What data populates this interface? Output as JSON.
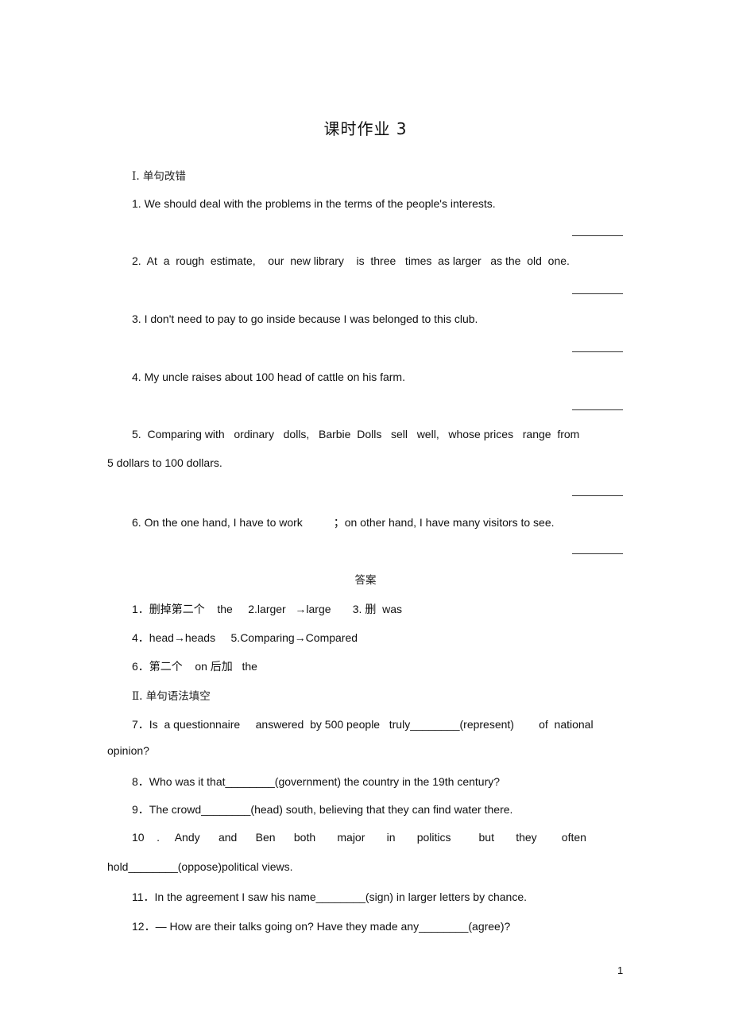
{
  "document": {
    "title": "课时作业 3",
    "page_number": "1"
  },
  "section1": {
    "heading": "Ⅰ. 单句改错",
    "items": [
      "1. We should deal with the problems in the terms of the people's interests.",
      "2.  At  a  rough  estimate,    our  new library    is  three   times  as larger   as the  old  one.",
      "3. I don't need to pay to go inside because I was belonged to this club.",
      "4. My uncle raises about 100 head of cattle on his farm.",
      "5.  Comparing with   ordinary   dolls,   Barbie  Dolls   sell   well,   whose prices   range  from",
      "5 dollars to 100 dollars.",
      "6. On the one hand, I have to work          ；on other hand, I have many visitors to see."
    ]
  },
  "answers": {
    "heading": "答案",
    "lines": [
      "1．删掉第二个    the     2.larger   →large       3. 删  was",
      "4．head→heads     5.Comparing→Compared",
      "6．第二个    on 后加   the"
    ]
  },
  "section2": {
    "heading": "Ⅱ. 单句语法填空",
    "items": [
      "7．Is  a questionnaire     answered  by 500 people   truly________(represent)        of  national",
      "opinion?",
      "8．Who was it that________(government) the country in the 19th century?",
      "9．The crowd________(head) south, believing that they can find water there.",
      "10    .     Andy      and      Ben      both       major       in       politics         but       they        often",
      "hold________(oppose)political views.",
      "11．In the agreement I saw his name________(sign) in larger letters by chance.",
      "12．— How are their talks going on? Have they made any________(agree)?"
    ]
  }
}
